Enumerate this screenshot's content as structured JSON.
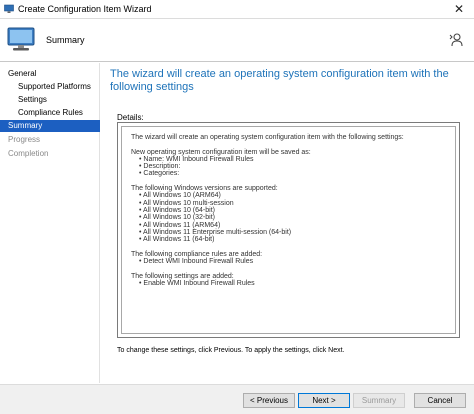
{
  "window": {
    "title": "Create Configuration Item Wizard",
    "close_glyph": "✕"
  },
  "header": {
    "page_title": "Summary"
  },
  "nav": {
    "items": [
      {
        "label": "General"
      },
      {
        "label": "Supported Platforms"
      },
      {
        "label": "Settings"
      },
      {
        "label": "Compliance Rules"
      },
      {
        "label": "Summary"
      },
      {
        "label": "Progress"
      },
      {
        "label": "Completion"
      }
    ]
  },
  "main": {
    "heading": "The wizard will create an operating system configuration item with the following settings",
    "details_label": "Details:",
    "details_lines": [
      "The wizard will create an operating system configuration item with the following settings:",
      "",
      "New operating system configuration item will be saved as:",
      "• Name: WMI Inbound Firewall Rules",
      "• Description:",
      "• Categories:",
      "",
      "The following Windows versions are supported:",
      "• All Windows 10 (ARM64)",
      "• All Windows 10 multi-session",
      "• All Windows 10 (64-bit)",
      "• All Windows 10 (32-bit)",
      "• All Windows 11 (ARM64)",
      "• All Windows 11 Enterprise multi-session (64-bit)",
      "• All Windows 11 (64-bit)",
      "",
      "The following compliance rules are added:",
      "• Detect WMI Inbound Firewall Rules",
      "",
      "The following settings are added:",
      "• Enable WMI Inbound Firewall Rules"
    ],
    "note": "To change these settings, click Previous. To apply the settings, click Next."
  },
  "footer": {
    "previous_label": "< Previous",
    "next_label": "Next >",
    "summary_label": "Summary",
    "cancel_label": "Cancel"
  },
  "colors": {
    "accent": "#1c5fc1",
    "heading": "#1e73b9"
  }
}
